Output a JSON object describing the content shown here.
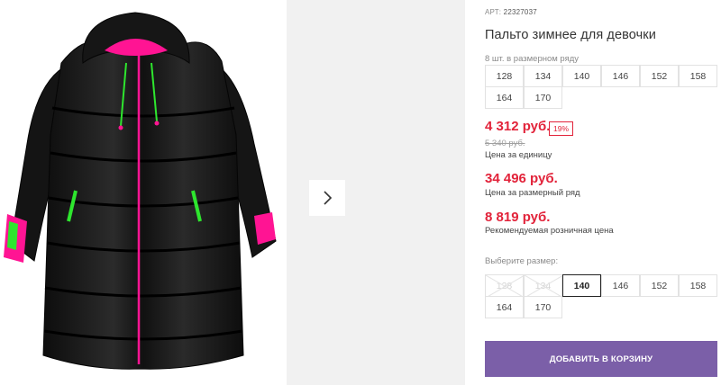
{
  "product": {
    "art_label": "АРТ:",
    "art_value": "22327037",
    "title": "Пальто зимнее для девочки",
    "in_row_text": "8 шт. в размерном ряду",
    "row_sizes": [
      "128",
      "134",
      "140",
      "146",
      "152",
      "158",
      "164",
      "170"
    ]
  },
  "prices": {
    "price": "4 312 руб.",
    "discount": "19%",
    "old_price": "5 340 руб.",
    "unit_label": "Цена за единицу",
    "row_price": "34 496 руб.",
    "row_label": "Цена за размерный ряд",
    "rrp": "8 819 руб.",
    "rrp_label": "Рекомендуемая розничная цена"
  },
  "size_picker": {
    "label": "Выберите размер:",
    "options": [
      {
        "label": "128",
        "state": "disabled"
      },
      {
        "label": "134",
        "state": "disabled"
      },
      {
        "label": "140",
        "state": "selected"
      },
      {
        "label": "146",
        "state": "available"
      },
      {
        "label": "152",
        "state": "available"
      },
      {
        "label": "158",
        "state": "available"
      },
      {
        "label": "164",
        "state": "available"
      },
      {
        "label": "170",
        "state": "available"
      }
    ]
  },
  "cart": {
    "button_label": "ДОБАВИТЬ В КОРЗИНУ"
  },
  "gallery": {
    "next_icon": "chevron-right-icon"
  },
  "colors": {
    "price_red": "#e2233a",
    "button_purple": "#7b5fa8",
    "coat_black": "#1a1a1a",
    "accent_pink": "#ff1493",
    "accent_green": "#2ee62e"
  }
}
